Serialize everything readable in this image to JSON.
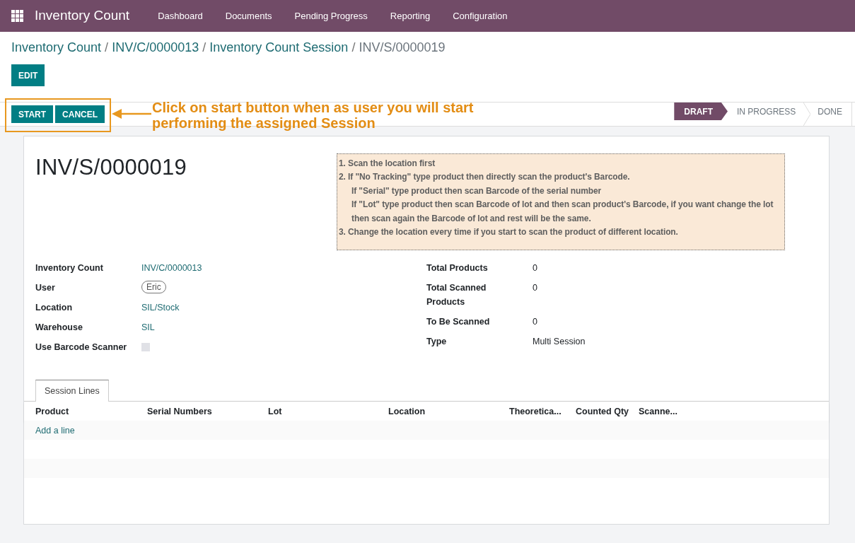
{
  "navbar": {
    "app_title": "Inventory Count",
    "menu": [
      "Dashboard",
      "Documents",
      "Pending Progress",
      "Reporting",
      "Configuration"
    ]
  },
  "breadcrumb": [
    {
      "label": "Inventory Count",
      "current": false
    },
    {
      "label": "INV/C/0000013",
      "current": false
    },
    {
      "label": "Inventory Count Session",
      "current": false
    },
    {
      "label": "INV/S/0000019",
      "current": true
    }
  ],
  "breadcrumb_separators": [
    "/",
    "/",
    "/"
  ],
  "edit_button": "EDIT",
  "action_buttons": [
    "START",
    "CANCEL"
  ],
  "annotation": {
    "text": "Click on start button when as user you will start performing the assigned Session"
  },
  "statusbar": [
    {
      "label": "DRAFT",
      "selected": true
    },
    {
      "label": "IN PROGRESS",
      "selected": false
    },
    {
      "label": "DONE",
      "selected": false
    }
  ],
  "record": {
    "title": "INV/S/0000019",
    "instructions": [
      {
        "text": "1. Scan the location first"
      },
      {
        "text": "2. If \"No Tracking\" type product then directly scan the product's Barcode.",
        "children": [
          {
            "text": "If \"Serial\" type product then scan Barcode of the serial number"
          },
          {
            "text": "If \"Lot\" type product then scan Barcode of lot and then scan product's Barcode, if you want change the lot then scan again the Barcode of lot and rest will be the same."
          }
        ]
      },
      {
        "text": "3. Change the location every time if you start to scan the product of different location."
      }
    ],
    "fields_left": [
      {
        "label": "Inventory Count",
        "value": "INV/C/0000013",
        "kind": "link"
      },
      {
        "label": "User",
        "value": "Eric",
        "kind": "tag"
      },
      {
        "label": "Location",
        "value": "SIL/Stock",
        "kind": "link"
      },
      {
        "label": "Warehouse",
        "value": "SIL",
        "kind": "link"
      },
      {
        "label": "Use Barcode Scanner",
        "kind": "checkbox",
        "checked": false
      }
    ],
    "fields_right": [
      {
        "label": "Total Products",
        "value": "0",
        "kind": "text"
      },
      {
        "label": "Total Scanned Products",
        "value": "0",
        "kind": "text"
      },
      {
        "label": "To Be Scanned",
        "value": "0",
        "kind": "text"
      },
      {
        "label": "Type",
        "value": "Multi Session",
        "kind": "text"
      }
    ]
  },
  "notebook": {
    "tabs": [
      {
        "label": "Session Lines",
        "selected": true
      }
    ],
    "table": {
      "columns": [
        "Product",
        "Serial Numbers",
        "Lot",
        "Location",
        "Theoretica...",
        "Counted Qty",
        "Scanne..."
      ],
      "add_line": "Add a line"
    }
  }
}
